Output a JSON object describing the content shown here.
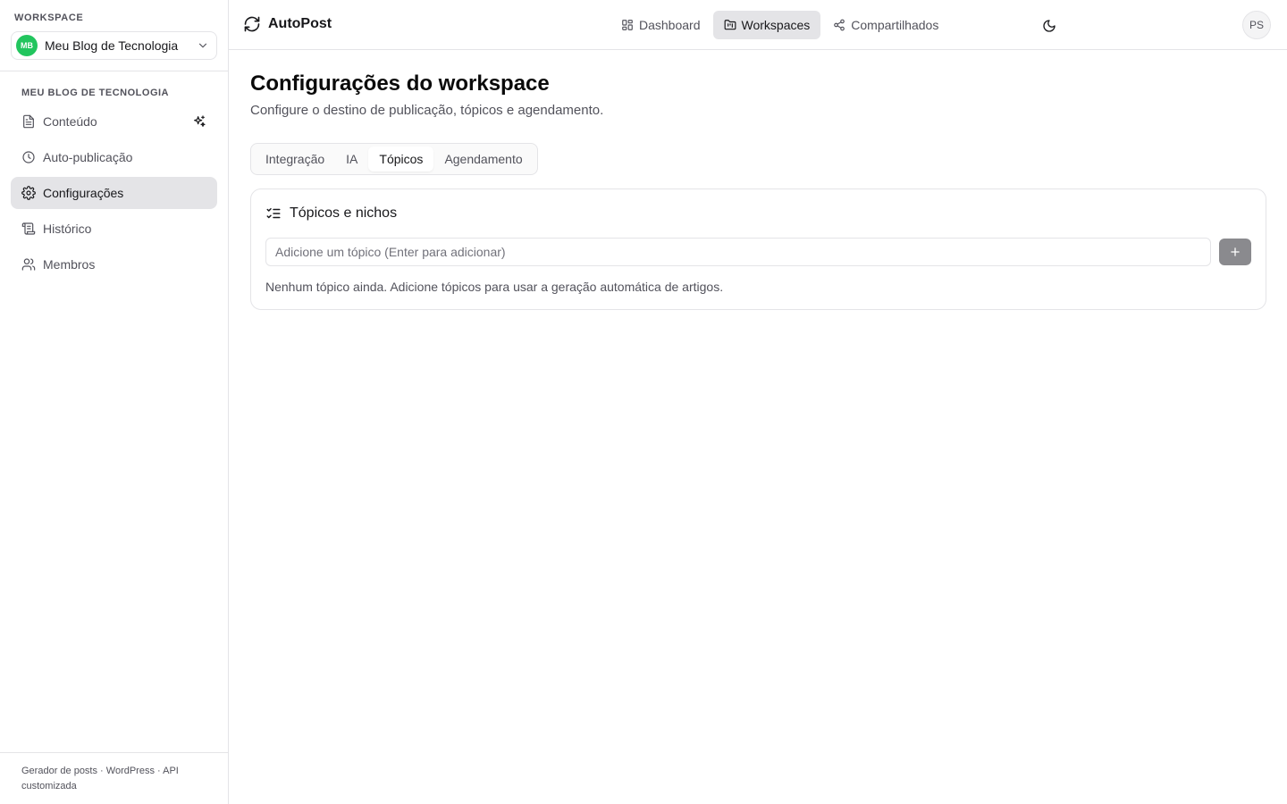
{
  "sidebar": {
    "workspace_label": "WORKSPACE",
    "workspace": {
      "initials": "MB",
      "name": "Meu Blog de Tecnologia",
      "avatar_color": "#22c55e"
    },
    "section_title": "MEU BLOG DE TECNOLOGIA",
    "items": [
      {
        "label": "Conteúdo",
        "icon": "file-text-icon"
      },
      {
        "label": "Auto-publicação",
        "icon": "clock-icon"
      },
      {
        "label": "Configurações",
        "icon": "gear-icon",
        "active": true
      },
      {
        "label": "Histórico",
        "icon": "scroll-icon"
      },
      {
        "label": "Membros",
        "icon": "users-icon"
      }
    ],
    "footer": "Gerador de posts · WordPress · API customizada"
  },
  "topbar": {
    "brand": "AutoPost",
    "nav": [
      {
        "label": "Dashboard",
        "icon": "dashboard-icon"
      },
      {
        "label": "Workspaces",
        "icon": "folder-icon",
        "active": true
      },
      {
        "label": "Compartilhados",
        "icon": "share-icon"
      }
    ],
    "user_initials": "PS"
  },
  "main": {
    "title": "Configurações do workspace",
    "subtitle": "Configure o destino de publicação, tópicos e agendamento.",
    "tabs": [
      {
        "label": "Integração"
      },
      {
        "label": "IA"
      },
      {
        "label": "Tópicos",
        "active": true
      },
      {
        "label": "Agendamento"
      }
    ],
    "card": {
      "title": "Tópicos e nichos",
      "input_placeholder": "Adicione um tópico (Enter para adicionar)",
      "input_value": "",
      "empty_message": "Nenhum tópico ainda. Adicione tópicos para usar a geração automática de artigos."
    }
  },
  "colors": {
    "accent_active_bg": "#e4e4e7",
    "border": "#e4e4e7",
    "add_button": "#8a8a8e"
  }
}
